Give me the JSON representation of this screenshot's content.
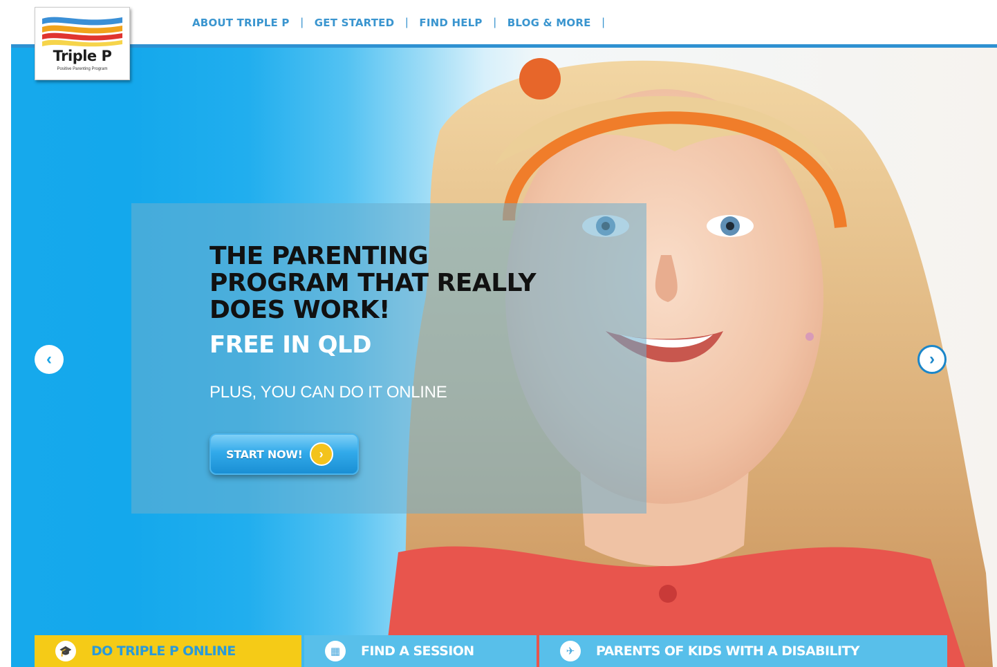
{
  "logo": {
    "name": "Triple P",
    "tagline": "Positive Parenting Program",
    "colors": [
      "#3a8fd6",
      "#f0a31c",
      "#e0342f",
      "#f6d44a"
    ]
  },
  "nav": {
    "items": [
      {
        "label": "ABOUT TRIPLE P"
      },
      {
        "label": "GET STARTED"
      },
      {
        "label": "FIND HELP"
      },
      {
        "label": "BLOG & MORE"
      }
    ],
    "separator": "|"
  },
  "hero": {
    "headline_lines": [
      "THE PARENTING",
      "PROGRAM THAT REALLY",
      "DOES WORK!"
    ],
    "subheadline": "FREE IN QLD",
    "tagline": "PLUS, YOU CAN DO IT ONLINE",
    "cta_label": "START NOW!",
    "cta_arrow": "›",
    "prev_arrow": "‹",
    "next_arrow": "›",
    "image_icon": "girl-photo"
  },
  "tabs": [
    {
      "label": "DO TRIPLE P ONLINE",
      "icon": "graduation-cap-icon",
      "glyph": "🎓"
    },
    {
      "label": "FIND A SESSION",
      "icon": "calendar-icon",
      "glyph": "▦"
    },
    {
      "label": "PARENTS OF KIDS WITH A DISABILITY",
      "icon": "bird-icon",
      "glyph": "✈"
    }
  ],
  "colors": {
    "accent_blue": "#2f91d1",
    "hero_blue": "#16a9ec",
    "tab_yellow": "#f5cb17",
    "tab_blue": "#58bfea"
  }
}
